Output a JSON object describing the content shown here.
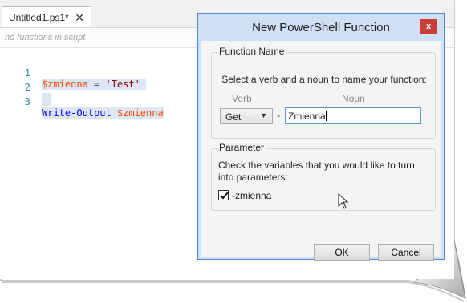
{
  "editor": {
    "tab_label": "Untitled1.ps1*",
    "tab_close": "✕",
    "functions_placeholder": "no functions in script",
    "lines": [
      {
        "num": "1",
        "var": "$zmienna",
        "op": " = ",
        "str": "'Test'"
      },
      {
        "num": "2"
      },
      {
        "num": "3",
        "cmd": "Write-Output",
        "var": " $zmienna"
      }
    ]
  },
  "dialog": {
    "title": "New PowerShell Function",
    "close_label": "x",
    "function_name_group": {
      "legend": "Function Name",
      "instruction": "Select a verb and a noun to name your function:",
      "verb_label": "Verb",
      "noun_label": "Noun",
      "verb_value": "Get",
      "separator": "-",
      "noun_value": "Zmienna"
    },
    "parameter_group": {
      "legend": "Parameter",
      "instruction": "Check the variables that you would like to turn into parameters:",
      "checkbox_label": "-zmienna",
      "checked": true
    },
    "ok_label": "OK",
    "cancel_label": "Cancel"
  },
  "colors": {
    "accent": "#4a8bd6",
    "close_red": "#c7403a",
    "variable": "#ff4500",
    "string": "#8b0000",
    "command": "#0000ff",
    "line_number": "#2b91af"
  }
}
